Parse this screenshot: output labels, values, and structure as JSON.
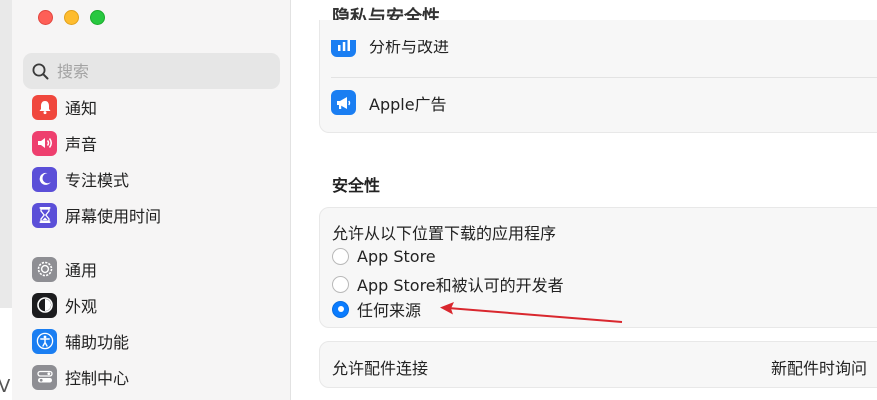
{
  "window": {
    "title": "隐私与安全性"
  },
  "sidebar": {
    "search_placeholder": "搜索",
    "items": [
      {
        "label": "通知",
        "icon": "bell-icon",
        "color": "#f0473d"
      },
      {
        "label": "声音",
        "icon": "speaker-icon",
        "color": "#ee3f6e"
      },
      {
        "label": "专注模式",
        "icon": "moon-icon",
        "color": "#5b4fd8"
      },
      {
        "label": "屏幕使用时间",
        "icon": "hourglass-icon",
        "color": "#5b4fd8"
      },
      {
        "label": "通用",
        "icon": "gear-icon",
        "color": "#8e8e93"
      },
      {
        "label": "外观",
        "icon": "appearance-icon",
        "color": "#1c1c1e"
      },
      {
        "label": "辅助功能",
        "icon": "accessibility-icon",
        "color": "#1a7ef2"
      },
      {
        "label": "控制中心",
        "icon": "control-center-icon",
        "color": "#8e8e93"
      }
    ]
  },
  "privacy_list": {
    "partial_label": "分析与改进",
    "apple_ads_label": "Apple广告",
    "accent": "#1a7ef2"
  },
  "security": {
    "section_title": "安全性",
    "question": "允许从以下位置下载的应用程序",
    "options": [
      {
        "label": "App Store",
        "selected": false
      },
      {
        "label": "App Store和被认可的开发者",
        "selected": false
      },
      {
        "label": "任何来源",
        "selected": true
      }
    ]
  },
  "accessories": {
    "label": "允许配件连接",
    "value": "新配件时询问"
  },
  "stray_text": "V",
  "annotation": {
    "color": "#d9272e"
  }
}
